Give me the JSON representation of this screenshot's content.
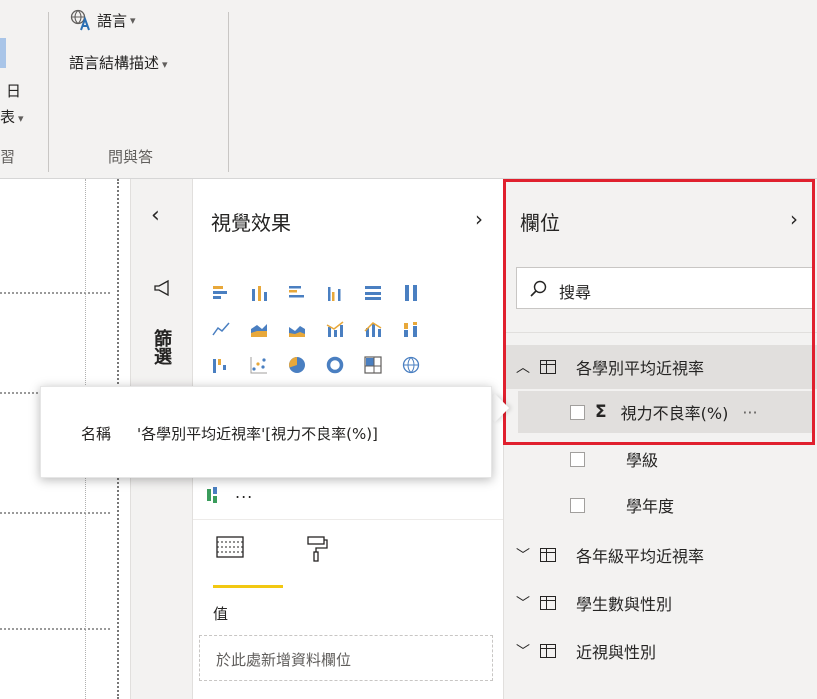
{
  "ribbon": {
    "partial_day_label": "日",
    "partial_table_label": "表",
    "partial_group_label": "習",
    "language_label": "語言",
    "linguistic_schema_label": "語言結構描述",
    "qa_group_label": "問與答"
  },
  "filters": {
    "label": "篩選"
  },
  "visualizations": {
    "title": "視覺效果",
    "more_label": "...",
    "values_label": "值",
    "drop_placeholder": "於此處新增資料欄位"
  },
  "fields": {
    "title": "欄位",
    "search_placeholder": "搜尋",
    "tables": [
      {
        "name": "各學別平均近視率",
        "expanded": true,
        "columns": [
          {
            "name": "視力不良率(%)",
            "sigma": true,
            "hovered": true,
            "more": "···"
          },
          {
            "name": "學級",
            "sigma": false
          },
          {
            "name": "學年度",
            "sigma": false
          }
        ]
      },
      {
        "name": "各年級平均近視率",
        "expanded": false
      },
      {
        "name": "學生數與性別",
        "expanded": false
      },
      {
        "name": "近視與性別",
        "expanded": false
      }
    ]
  },
  "tooltip": {
    "label": "名稱",
    "value": "'各學別平均近視率'[視力不良率(%)]"
  },
  "colors": {
    "highlight_border": "#e0202e",
    "format_underline": "#f2c811",
    "pane_bg": "#f3f2f1"
  }
}
